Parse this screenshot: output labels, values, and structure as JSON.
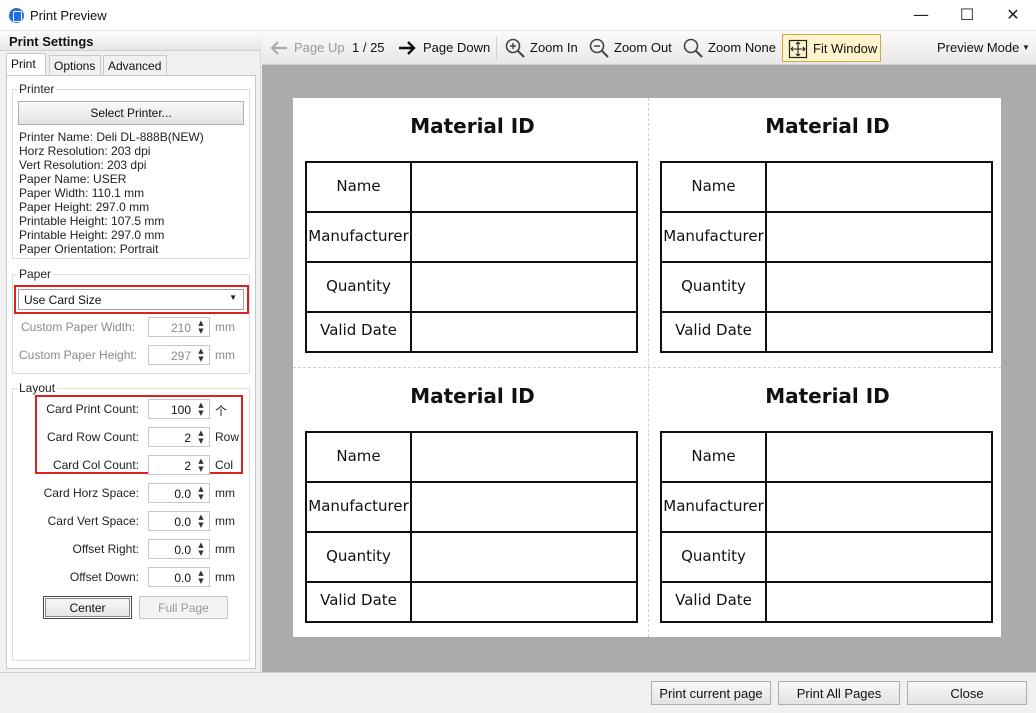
{
  "window": {
    "title": "Print Preview",
    "min_glyph": "—",
    "max_glyph": "☐",
    "close_glyph": "✕"
  },
  "left": {
    "header": "Print Settings",
    "tabs": [
      {
        "label": "Print"
      },
      {
        "label": "Options"
      },
      {
        "label": "Advanced"
      }
    ],
    "printer": {
      "group_label": "Printer",
      "select_button": "Select Printer...",
      "info": [
        "Printer Name: Deli DL-888B(NEW)",
        "Horz Resolution: 203 dpi",
        "Vert Resolution: 203 dpi",
        "Paper Name: USER",
        "Paper Width: 110.1 mm",
        "Paper Height: 297.0 mm",
        "Printable Height: 107.5 mm",
        "Printable Height: 297.0 mm",
        "Paper Orientation: Portrait"
      ]
    },
    "paper": {
      "group_label": "Paper",
      "mode": "Use Card Size",
      "custom_width": {
        "label": "Custom Paper Width:",
        "value": "210",
        "unit": "mm"
      },
      "custom_height": {
        "label": "Custom Paper Height:",
        "value": "297",
        "unit": "mm"
      }
    },
    "layout": {
      "group_label": "Layout",
      "fields": [
        {
          "label": "Card Print Count:",
          "value": "100",
          "unit": "个"
        },
        {
          "label": "Card Row Count:",
          "value": "2",
          "unit": "Row"
        },
        {
          "label": "Card Col Count:",
          "value": "2",
          "unit": "Col"
        },
        {
          "label": "Card Horz Space:",
          "value": "0.0",
          "unit": "mm"
        },
        {
          "label": "Card Vert Space:",
          "value": "0.0",
          "unit": "mm"
        },
        {
          "label": "Offset Right:",
          "value": "0.0",
          "unit": "mm"
        },
        {
          "label": "Offset Down:",
          "value": "0.0",
          "unit": "mm"
        }
      ],
      "center_button": "Center",
      "fullpage_button": "Full Page"
    }
  },
  "toolbar": {
    "page_up": "Page Up",
    "page_indicator": "1 / 25",
    "page_down": "Page Down",
    "zoom_in": "Zoom In",
    "zoom_out": "Zoom Out",
    "zoom_none": "Zoom None",
    "fit_window": "Fit Window",
    "preview_mode": "Preview Mode"
  },
  "card": {
    "title": "Material ID",
    "rows": [
      "Name",
      "Manufacturer",
      "Quantity",
      "Valid Date"
    ]
  },
  "bottom": {
    "print_current": "Print current page",
    "print_all": "Print All Pages",
    "close": "Close"
  },
  "colors": {
    "highlight_frame": "#e02020",
    "preview_bg": "#ababab",
    "fit_window_bg": "#fff4cc"
  }
}
